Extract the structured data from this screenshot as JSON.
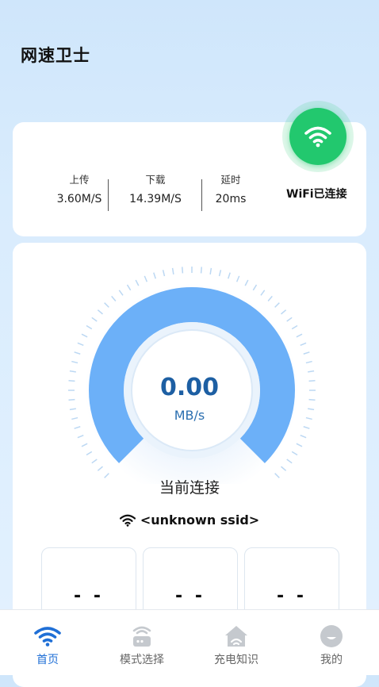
{
  "app": {
    "title": "网速卫士"
  },
  "stats": {
    "upload": {
      "label": "上传",
      "value": "3.60M/S"
    },
    "download": {
      "label": "下载",
      "value": "14.39M/S"
    },
    "latency": {
      "label": "延时",
      "value": "20ms"
    }
  },
  "wifi": {
    "status": "WiFi已连接",
    "icon": "wifi-icon",
    "color": "#22c86e"
  },
  "gauge": {
    "speed": "0.00",
    "unit": "MB/s",
    "fill_fraction": 0.0
  },
  "connection": {
    "label": "当前连接",
    "ssid": "<unknown ssid>"
  },
  "boxes": [
    {
      "value": "- -"
    },
    {
      "value": "- -"
    },
    {
      "value": "- -"
    }
  ],
  "tabs": [
    {
      "label": "首页",
      "icon": "wifi-icon",
      "active": true
    },
    {
      "label": "模式选择",
      "icon": "router-icon",
      "active": false
    },
    {
      "label": "充电知识",
      "icon": "home-icon",
      "active": false
    },
    {
      "label": "我的",
      "icon": "profile-icon",
      "active": false
    }
  ],
  "colors": {
    "accent": "#1f6fd6",
    "gauge": "#6cb0f8",
    "wifi_green": "#22c86e"
  }
}
